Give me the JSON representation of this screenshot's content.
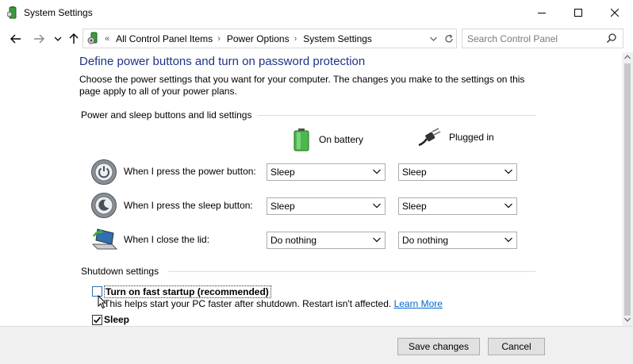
{
  "window": {
    "title": "System Settings"
  },
  "address": {
    "lead": "«",
    "crumbs": [
      "All Control Panel Items",
      "Power Options",
      "System Settings"
    ],
    "search_placeholder": "Search Control Panel"
  },
  "page": {
    "heading": "Define power buttons and turn on password protection",
    "description": "Choose the power settings that you want for your computer. The changes you make to the settings on this page apply to all of your power plans."
  },
  "power_section": {
    "label": "Power and sleep buttons and lid settings",
    "col_battery": "On battery",
    "col_plugged": "Plugged in",
    "rows": [
      {
        "label": "When I press the power button:",
        "battery": "Sleep",
        "plugged": "Sleep"
      },
      {
        "label": "When I press the sleep button:",
        "battery": "Sleep",
        "plugged": "Sleep"
      },
      {
        "label": "When I close the lid:",
        "battery": "Do nothing",
        "plugged": "Do nothing"
      }
    ]
  },
  "shutdown_section": {
    "label": "Shutdown settings",
    "fast_startup_label": "Turn on fast startup (recommended)",
    "fast_startup_checked": false,
    "fast_startup_note": "This helps start your PC faster after shutdown. Restart isn't affected.",
    "learn_more": "Learn More",
    "sleep_label": "Sleep",
    "sleep_checked": true
  },
  "footer": {
    "save_label": "Save changes",
    "cancel_label": "Cancel"
  },
  "colors": {
    "heading": "#1e3287",
    "link": "#0066cc",
    "footer_bg": "#f0f0f0"
  }
}
